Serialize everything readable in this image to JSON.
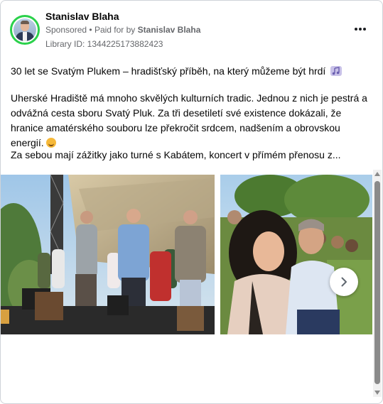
{
  "post": {
    "author": "Stanislav Blaha",
    "sponsored": "Sponsored",
    "paid_for_prefix": "Paid for by",
    "paid_for_name": "Stanislav Blaha",
    "library_id": "Library ID: 1344225173882423",
    "title_line": "30 let se Svatým Plukem – hradišťský příběh, na který můžeme být hrdí",
    "paragraph": "Uherské Hradiště má mnoho skvělých kulturních tradic. Jednou z nich je pestrá a odvážná cesta sboru Svatý Pluk. Za tři desetiletí své existence dokázali, že hranice amatérského souboru lze překročit srdcem, nadšením a obrovskou energií.",
    "truncated_line": "Za sebou mají zážitky jako turné s Kabátem, koncert v přímém přenosu z..."
  },
  "icons": {
    "music_note": "musical-notes-emoji",
    "smile": "smiling-face-emoji",
    "more": "more-options-icon",
    "next": "chevron-right-icon"
  },
  "colors": {
    "avatar_ring": "#2bd14b",
    "meta_text": "#65676b"
  }
}
